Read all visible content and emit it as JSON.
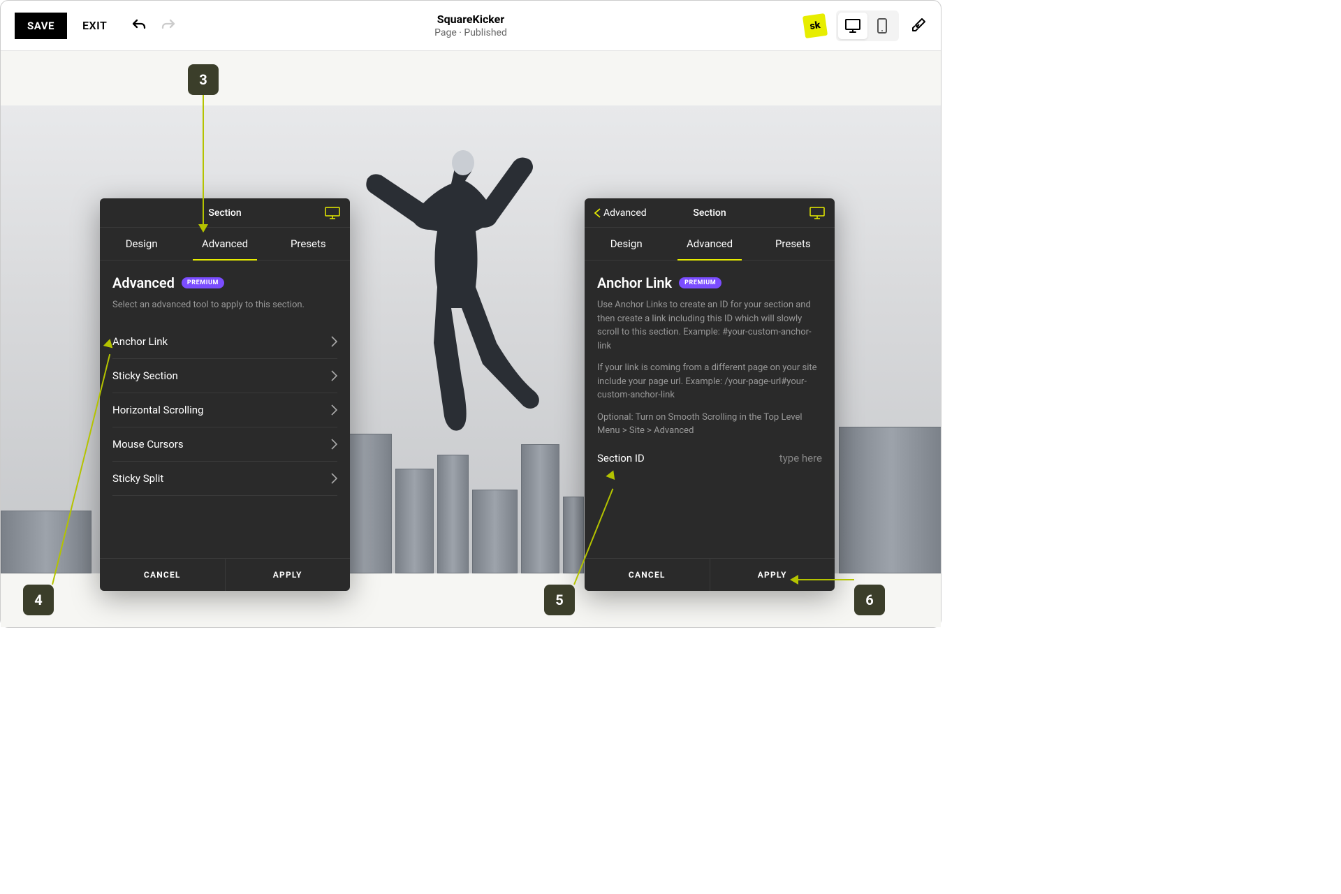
{
  "toolbar": {
    "save": "SAVE",
    "exit": "EXIT",
    "title": "SquareKicker",
    "subtitle": "Page · Published",
    "sk_badge": "sk"
  },
  "panel_left": {
    "section": "Section",
    "tabs": {
      "design": "Design",
      "advanced": "Advanced",
      "presets": "Presets"
    },
    "title": "Advanced",
    "badge": "PREMIUM",
    "desc": "Select an advanced tool to apply to this section.",
    "tools": [
      "Anchor Link",
      "Sticky Section",
      "Horizontal Scrolling",
      "Mouse Cursors",
      "Sticky Split"
    ],
    "cancel": "CANCEL",
    "apply": "APPLY"
  },
  "panel_right": {
    "back": "Advanced",
    "section": "Section",
    "tabs": {
      "design": "Design",
      "advanced": "Advanced",
      "presets": "Presets"
    },
    "title": "Anchor Link",
    "badge": "PREMIUM",
    "desc1": "Use Anchor Links to create an ID for your section and then create a link including this ID which will slowly scroll to this section. Example: #your-custom-anchor-link",
    "desc2": "If your link is coming from a different page on your site include your page url. Example: /your-page-url#your-custom-anchor-link",
    "desc3": "Optional: Turn on Smooth Scrolling in the Top Level Menu > Site > Advanced",
    "field_label": "Section ID",
    "field_placeholder": "type here",
    "cancel": "CANCEL",
    "apply": "APPLY"
  },
  "callouts": {
    "c3": "3",
    "c4": "4",
    "c5": "5",
    "c6": "6"
  }
}
